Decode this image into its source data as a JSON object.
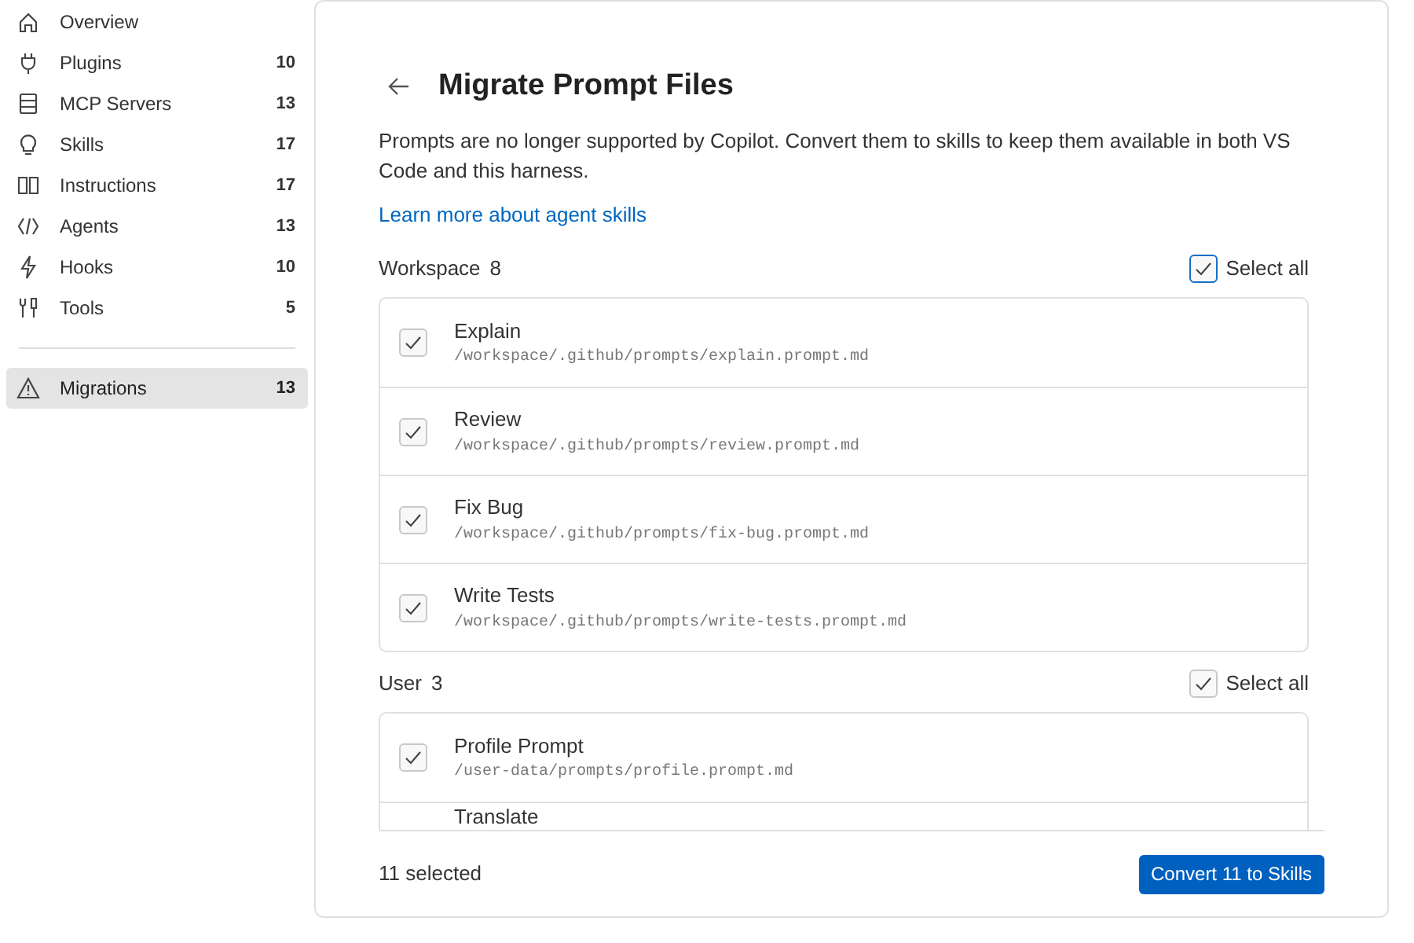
{
  "sidebar": {
    "items": [
      {
        "label": "Overview",
        "selected": false
      },
      {
        "label": "Plugins",
        "count": "10",
        "selected": false
      },
      {
        "label": "MCP Servers",
        "count": "13",
        "selected": false
      },
      {
        "label": "Skills",
        "count": "17",
        "selected": false
      },
      {
        "label": "Instructions",
        "count": "17",
        "selected": false
      },
      {
        "label": "Agents",
        "count": "13",
        "selected": false
      },
      {
        "label": "Hooks",
        "count": "10",
        "selected": false
      },
      {
        "label": "Tools",
        "count": "5",
        "selected": false
      }
    ],
    "footer_items": [
      {
        "label": "Migrations",
        "count": "13",
        "selected": true
      }
    ]
  },
  "page": {
    "title": "Migrate Prompt Files",
    "description": "Prompts are no longer supported by Copilot. Convert them to skills to keep them available in both VS Code and this harness.",
    "link": "Learn more about agent skills",
    "groups": [
      {
        "label": "Workspace",
        "count": "8",
        "select_all": {
          "label": "Select all",
          "checked": true,
          "focused": true
        },
        "files": [
          {
            "name": "Explain",
            "path": "/workspace/.github/prompts/explain.prompt.md",
            "checked": true
          },
          {
            "name": "Review",
            "path": "/workspace/.github/prompts/review.prompt.md",
            "checked": true
          },
          {
            "name": "Fix Bug",
            "path": "/workspace/.github/prompts/fix-bug.prompt.md",
            "checked": true
          },
          {
            "name": "Write Tests",
            "path": "/workspace/.github/prompts/write-tests.prompt.md",
            "checked": true
          }
        ]
      },
      {
        "label": "User",
        "count": "3",
        "select_all": {
          "label": "Select all",
          "checked": true,
          "focused": false
        },
        "files": [
          {
            "name": "Profile Prompt",
            "path": "/user-data/prompts/profile.prompt.md",
            "checked": true
          },
          {
            "name": "Translate"
          }
        ]
      }
    ],
    "footer": {
      "summary": "11 selected",
      "button": "Convert 11 to Skills"
    }
  }
}
